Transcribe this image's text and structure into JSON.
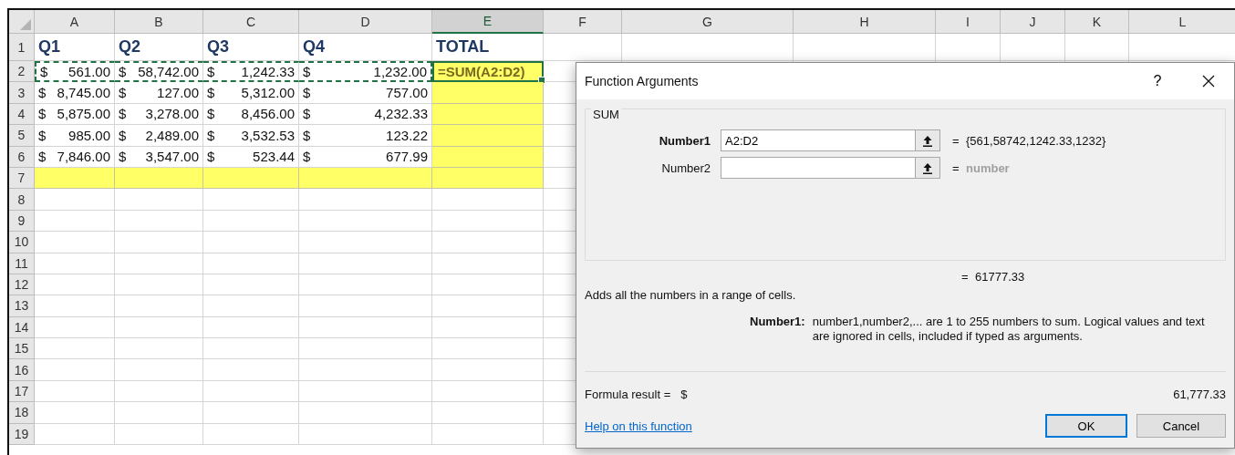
{
  "sheet": {
    "columns": [
      {
        "label": "A",
        "selected": false
      },
      {
        "label": "B",
        "selected": false
      },
      {
        "label": "C",
        "selected": false
      },
      {
        "label": "D",
        "selected": false
      },
      {
        "label": "E",
        "selected": true
      },
      {
        "label": "F",
        "selected": false
      },
      {
        "label": "G",
        "selected": false
      },
      {
        "label": "H",
        "selected": false
      },
      {
        "label": "I",
        "selected": false
      },
      {
        "label": "J",
        "selected": false
      },
      {
        "label": "K",
        "selected": false
      },
      {
        "label": "L",
        "selected": false
      }
    ],
    "rows": [
      {
        "header": "1",
        "cells": [
          {
            "kind": "heading",
            "text": "Q1",
            "highlighted": false,
            "selected": false,
            "referenced": false
          },
          {
            "kind": "heading",
            "text": "Q2",
            "highlighted": false,
            "selected": false,
            "referenced": false
          },
          {
            "kind": "heading",
            "text": "Q3",
            "highlighted": false,
            "selected": false,
            "referenced": false
          },
          {
            "kind": "heading",
            "text": "Q4",
            "highlighted": false,
            "selected": false,
            "referenced": false
          },
          {
            "kind": "heading",
            "text": "TOTAL",
            "highlighted": false,
            "selected": false,
            "referenced": false
          }
        ]
      },
      {
        "header": "2",
        "cells": [
          {
            "kind": "currency",
            "symbol": "$",
            "text": "561.00",
            "highlighted": false,
            "selected": false,
            "referenced": true
          },
          {
            "kind": "currency",
            "symbol": "$",
            "text": "58,742.00",
            "highlighted": false,
            "selected": false,
            "referenced": true
          },
          {
            "kind": "currency",
            "symbol": "$",
            "text": "1,242.33",
            "highlighted": false,
            "selected": false,
            "referenced": true
          },
          {
            "kind": "currency",
            "symbol": "$",
            "text": "1,232.00",
            "highlighted": false,
            "selected": false,
            "referenced": true
          },
          {
            "kind": "formula",
            "text": "=SUM(A2:D2)",
            "highlighted": true,
            "selected": true,
            "referenced": false
          }
        ]
      },
      {
        "header": "3",
        "cells": [
          {
            "kind": "currency",
            "symbol": "$",
            "text": "8,745.00",
            "highlighted": false,
            "selected": false,
            "referenced": false
          },
          {
            "kind": "currency",
            "symbol": "$",
            "text": "127.00",
            "highlighted": false,
            "selected": false,
            "referenced": false
          },
          {
            "kind": "currency",
            "symbol": "$",
            "text": "5,312.00",
            "highlighted": false,
            "selected": false,
            "referenced": false
          },
          {
            "kind": "currency",
            "symbol": "$",
            "text": "757.00",
            "highlighted": false,
            "selected": false,
            "referenced": false
          },
          {
            "kind": "empty",
            "highlighted": true,
            "selected": false,
            "referenced": false
          }
        ]
      },
      {
        "header": "4",
        "cells": [
          {
            "kind": "currency",
            "symbol": "$",
            "text": "5,875.00",
            "highlighted": false,
            "selected": false,
            "referenced": false
          },
          {
            "kind": "currency",
            "symbol": "$",
            "text": "3,278.00",
            "highlighted": false,
            "selected": false,
            "referenced": false
          },
          {
            "kind": "currency",
            "symbol": "$",
            "text": "8,456.00",
            "highlighted": false,
            "selected": false,
            "referenced": false
          },
          {
            "kind": "currency",
            "symbol": "$",
            "text": "4,232.33",
            "highlighted": false,
            "selected": false,
            "referenced": false
          },
          {
            "kind": "empty",
            "highlighted": true,
            "selected": false,
            "referenced": false
          }
        ]
      },
      {
        "header": "5",
        "cells": [
          {
            "kind": "currency",
            "symbol": "$",
            "text": "985.00",
            "highlighted": false,
            "selected": false,
            "referenced": false
          },
          {
            "kind": "currency",
            "symbol": "$",
            "text": "2,489.00",
            "highlighted": false,
            "selected": false,
            "referenced": false
          },
          {
            "kind": "currency",
            "symbol": "$",
            "text": "3,532.53",
            "highlighted": false,
            "selected": false,
            "referenced": false
          },
          {
            "kind": "currency",
            "symbol": "$",
            "text": "123.22",
            "highlighted": false,
            "selected": false,
            "referenced": false
          },
          {
            "kind": "empty",
            "highlighted": true,
            "selected": false,
            "referenced": false
          }
        ]
      },
      {
        "header": "6",
        "cells": [
          {
            "kind": "currency",
            "symbol": "$",
            "text": "7,846.00",
            "highlighted": false,
            "selected": false,
            "referenced": false
          },
          {
            "kind": "currency",
            "symbol": "$",
            "text": "3,547.00",
            "highlighted": false,
            "selected": false,
            "referenced": false
          },
          {
            "kind": "currency",
            "symbol": "$",
            "text": "523.44",
            "highlighted": false,
            "selected": false,
            "referenced": false
          },
          {
            "kind": "currency",
            "symbol": "$",
            "text": "677.99",
            "highlighted": false,
            "selected": false,
            "referenced": false
          },
          {
            "kind": "empty",
            "highlighted": true,
            "selected": false,
            "referenced": false
          }
        ]
      },
      {
        "header": "7",
        "cells": [
          {
            "kind": "empty",
            "highlighted": true,
            "selected": false,
            "referenced": false
          },
          {
            "kind": "empty",
            "highlighted": true,
            "selected": false,
            "referenced": false
          },
          {
            "kind": "empty",
            "highlighted": true,
            "selected": false,
            "referenced": false
          },
          {
            "kind": "empty",
            "highlighted": true,
            "selected": false,
            "referenced": false
          },
          {
            "kind": "empty",
            "highlighted": true,
            "selected": false,
            "referenced": false
          }
        ]
      },
      {
        "header": "8"
      },
      {
        "header": "9"
      },
      {
        "header": "10"
      },
      {
        "header": "11"
      },
      {
        "header": "12"
      },
      {
        "header": "13"
      },
      {
        "header": "14"
      },
      {
        "header": "15"
      },
      {
        "header": "16"
      },
      {
        "header": "17"
      },
      {
        "header": "18"
      },
      {
        "header": "19"
      }
    ]
  },
  "dialog": {
    "title": "Function Arguments",
    "help": "?",
    "group": "SUM",
    "arguments": [
      {
        "label": "Number1",
        "value": "A2:D2",
        "eq": "=",
        "result": "{561,58742,1242.33,1232}",
        "active": true
      },
      {
        "label": "Number2",
        "eq": "=",
        "result": "number",
        "active": false
      }
    ],
    "total": {
      "eq": "=",
      "value": "61777.33"
    },
    "description": "Adds all the numbers in a range of cells.",
    "arg_help": {
      "label": "Number1:",
      "text": "number1,number2,... are 1 to 255 numbers to sum. Logical values and text are ignored in cells, included if typed as arguments."
    },
    "formula_result": {
      "label": "Formula result =",
      "symbol": "$",
      "value": "61,777.33"
    },
    "help_link": "Help on this function",
    "buttons": [
      {
        "label": "OK",
        "default": true
      },
      {
        "label": "Cancel",
        "default": false
      }
    ]
  }
}
